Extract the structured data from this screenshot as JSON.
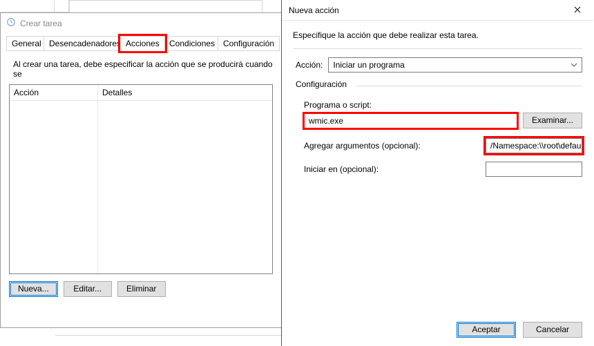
{
  "createTask": {
    "title": "Crear tarea",
    "tabs": {
      "general": "General",
      "triggers": "Desencadenadores",
      "actions": "Acciones",
      "conditions": "Condiciones",
      "settings": "Configuración"
    },
    "description": "Al crear una tarea, debe especificar la acción que se producirá cuando se",
    "columns": {
      "action": "Acción",
      "details": "Detalles"
    },
    "buttons": {
      "new": "Nueva...",
      "edit": "Editar...",
      "delete": "Eliminar"
    }
  },
  "newAction": {
    "title": "Nueva acción",
    "instruction": "Especifique la acción que debe realizar esta tarea.",
    "actionLabel": "Acción:",
    "actionSelected": "Iniciar un programa",
    "groupLabel": "Configuración",
    "programLabel": "Programa o script:",
    "programValue": "wmic.exe",
    "browse": "Examinar...",
    "argsLabel": "Agregar argumentos (opcional):",
    "argsValue": "/Namespace:\\\\root\\defau",
    "startInLabel": "Iniciar en (opcional):",
    "startInValue": "",
    "ok": "Aceptar",
    "cancel": "Cancelar"
  }
}
